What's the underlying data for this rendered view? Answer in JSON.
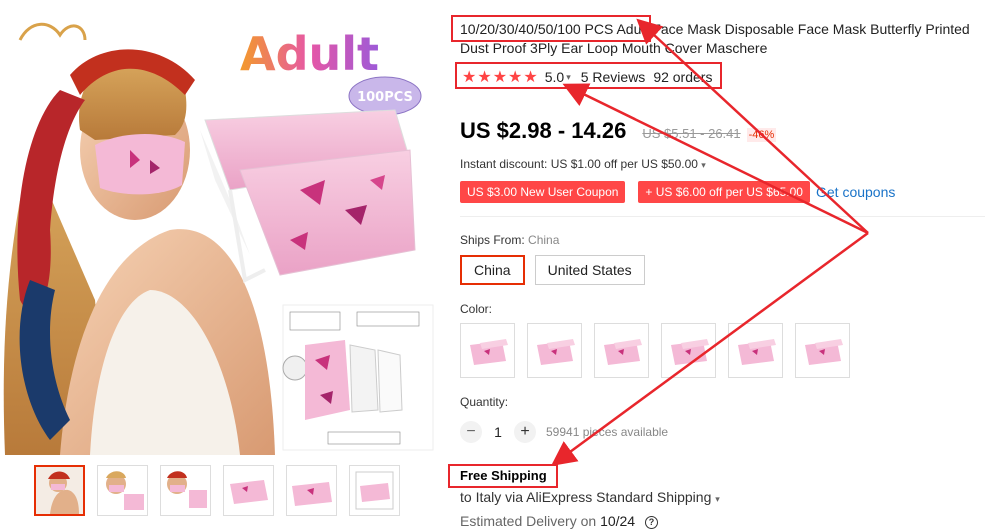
{
  "product": {
    "title": "10/20/30/40/50/100 PCS Adult Face Mask Disposable Face Mask Butterfly Printed Dust Proof 3Ply Ear Loop Mouth Cover Maschere",
    "rating": {
      "score": "5.0",
      "reviews": "5 Reviews",
      "orders": "92 orders"
    },
    "price": "US $2.98 - 14.26",
    "old_price": "US $5.51 - 26.41",
    "discount": "-46%",
    "instant_discount": "Instant discount: US $1.00 off per US $50.00",
    "coupons": [
      "US $3.00 New User Coupon",
      "+ US $6.00 off per US $65.00"
    ],
    "get_coupons": "Get coupons"
  },
  "gallery": {
    "badge_text": "Adult",
    "badge_pcs": "100PCS",
    "thumbnail_count": 6
  },
  "shipping": {
    "ships_from_label": "Ships From:",
    "ships_from_value": "China",
    "options": [
      "China",
      "United States"
    ],
    "selected": "China",
    "free_shipping": "Free Shipping",
    "ship_to": "to Italy via AliExpress Standard Shipping",
    "est_label": "Estimated Delivery on",
    "est_date": "10/24"
  },
  "color": {
    "label": "Color:",
    "swatch_count": 6
  },
  "quantity": {
    "label": "Quantity:",
    "value": "1",
    "available": "59941 pieces available"
  },
  "icons": [
    "star-icon",
    "chevron-down-icon",
    "minus-icon",
    "plus-icon",
    "help-icon"
  ],
  "colors": {
    "accent": "#ff4747",
    "annotation": "#e8262c",
    "link": "#1a73c8",
    "mask_pink": "#f4b9d6",
    "butterfly": "#c8327c"
  }
}
